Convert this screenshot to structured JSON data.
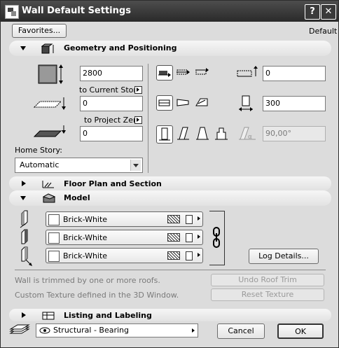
{
  "window": {
    "title": "Wall Default Settings",
    "help": "?",
    "close": "✕"
  },
  "top": {
    "favorites": "Favorites...",
    "default_label": "Default"
  },
  "geometry": {
    "title": "Geometry and Positioning",
    "height_value": "2800",
    "to_current_story": "to Current Story",
    "base_offset_value": "0",
    "to_project_zero": "to Project Zero",
    "bottom_value": "0",
    "home_story_label": "Home Story:",
    "home_story_value": "Automatic",
    "offset_value": "0",
    "thickness_value": "300",
    "slant_value": "90,00°"
  },
  "sections": {
    "floor_plan": "Floor Plan and Section",
    "model": "Model",
    "listing": "Listing and Labeling"
  },
  "model": {
    "materials": [
      "Brick-White",
      "Brick-White",
      "Brick-White"
    ],
    "log_details": "Log Details...",
    "roof_msg": "Wall is trimmed by one or more roofs.",
    "texture_msg": "Custom Texture defined in the 3D Window.",
    "undo_roof_trim": "Undo Roof Trim",
    "reset_texture": "Reset Texture"
  },
  "bottom": {
    "layer": "Structural - Bearing",
    "cancel": "Cancel",
    "ok": "OK"
  },
  "colors": {
    "titlebar": "#333333",
    "panel": "#dcdcdc"
  }
}
